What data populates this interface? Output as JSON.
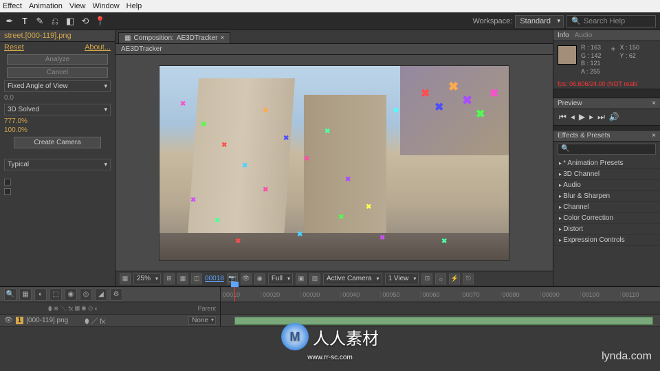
{
  "menubar": [
    "Effect",
    "Animation",
    "View",
    "Window",
    "Help"
  ],
  "workspace": {
    "label": "Workspace:",
    "value": "Standard"
  },
  "search": {
    "placeholder": "Search Help"
  },
  "left": {
    "project_item": "street.[000-119].png",
    "reset": "Reset",
    "about": "About...",
    "analyze": "Analyze",
    "cancel": "Cancel",
    "angle_mode": "Fixed Angle of View",
    "angle_val": "0.0",
    "solve": "3D Solved",
    "err1": "777.0%",
    "err2": "100.0%",
    "create_camera": "Create Camera",
    "method": "Typical"
  },
  "comp": {
    "tab_prefix": "Composition:",
    "name": "AE3DTracker",
    "layer_tab": "AE3DTracker"
  },
  "viewer": {
    "zoom": "25%",
    "frame": "00018",
    "res": "Full",
    "camera": "Active Camera",
    "view": "1 View"
  },
  "info": {
    "tab1": "Info",
    "tab2": "Audio",
    "r": "R : 163",
    "g": "G : 142",
    "b": "B : 121",
    "a": "A : 255",
    "x": "X : 150",
    "y": "Y : 62",
    "fps": "fps: 06.606/24.00  (NOT realti"
  },
  "preview": {
    "tab": "Preview"
  },
  "effects": {
    "tab": "Effects & Presets",
    "items": [
      "* Animation Presets",
      "3D Channel",
      "Audio",
      "Blur & Sharpen",
      "Channel",
      "Color Correction",
      "Distort",
      "Expression Controls"
    ]
  },
  "timeline": {
    "header_icons": [],
    "ruler": [
      "00010",
      "00020",
      "00030",
      "00040",
      "00050",
      "00060",
      "00070",
      "00080",
      "00090",
      "00100",
      "00110"
    ],
    "parent_label": "Parent",
    "none": "None",
    "layer": "[000-119].png"
  },
  "watermark": {
    "text": "人人素材",
    "url": "www.rr-sc.com"
  },
  "lynda": "lynda.com"
}
